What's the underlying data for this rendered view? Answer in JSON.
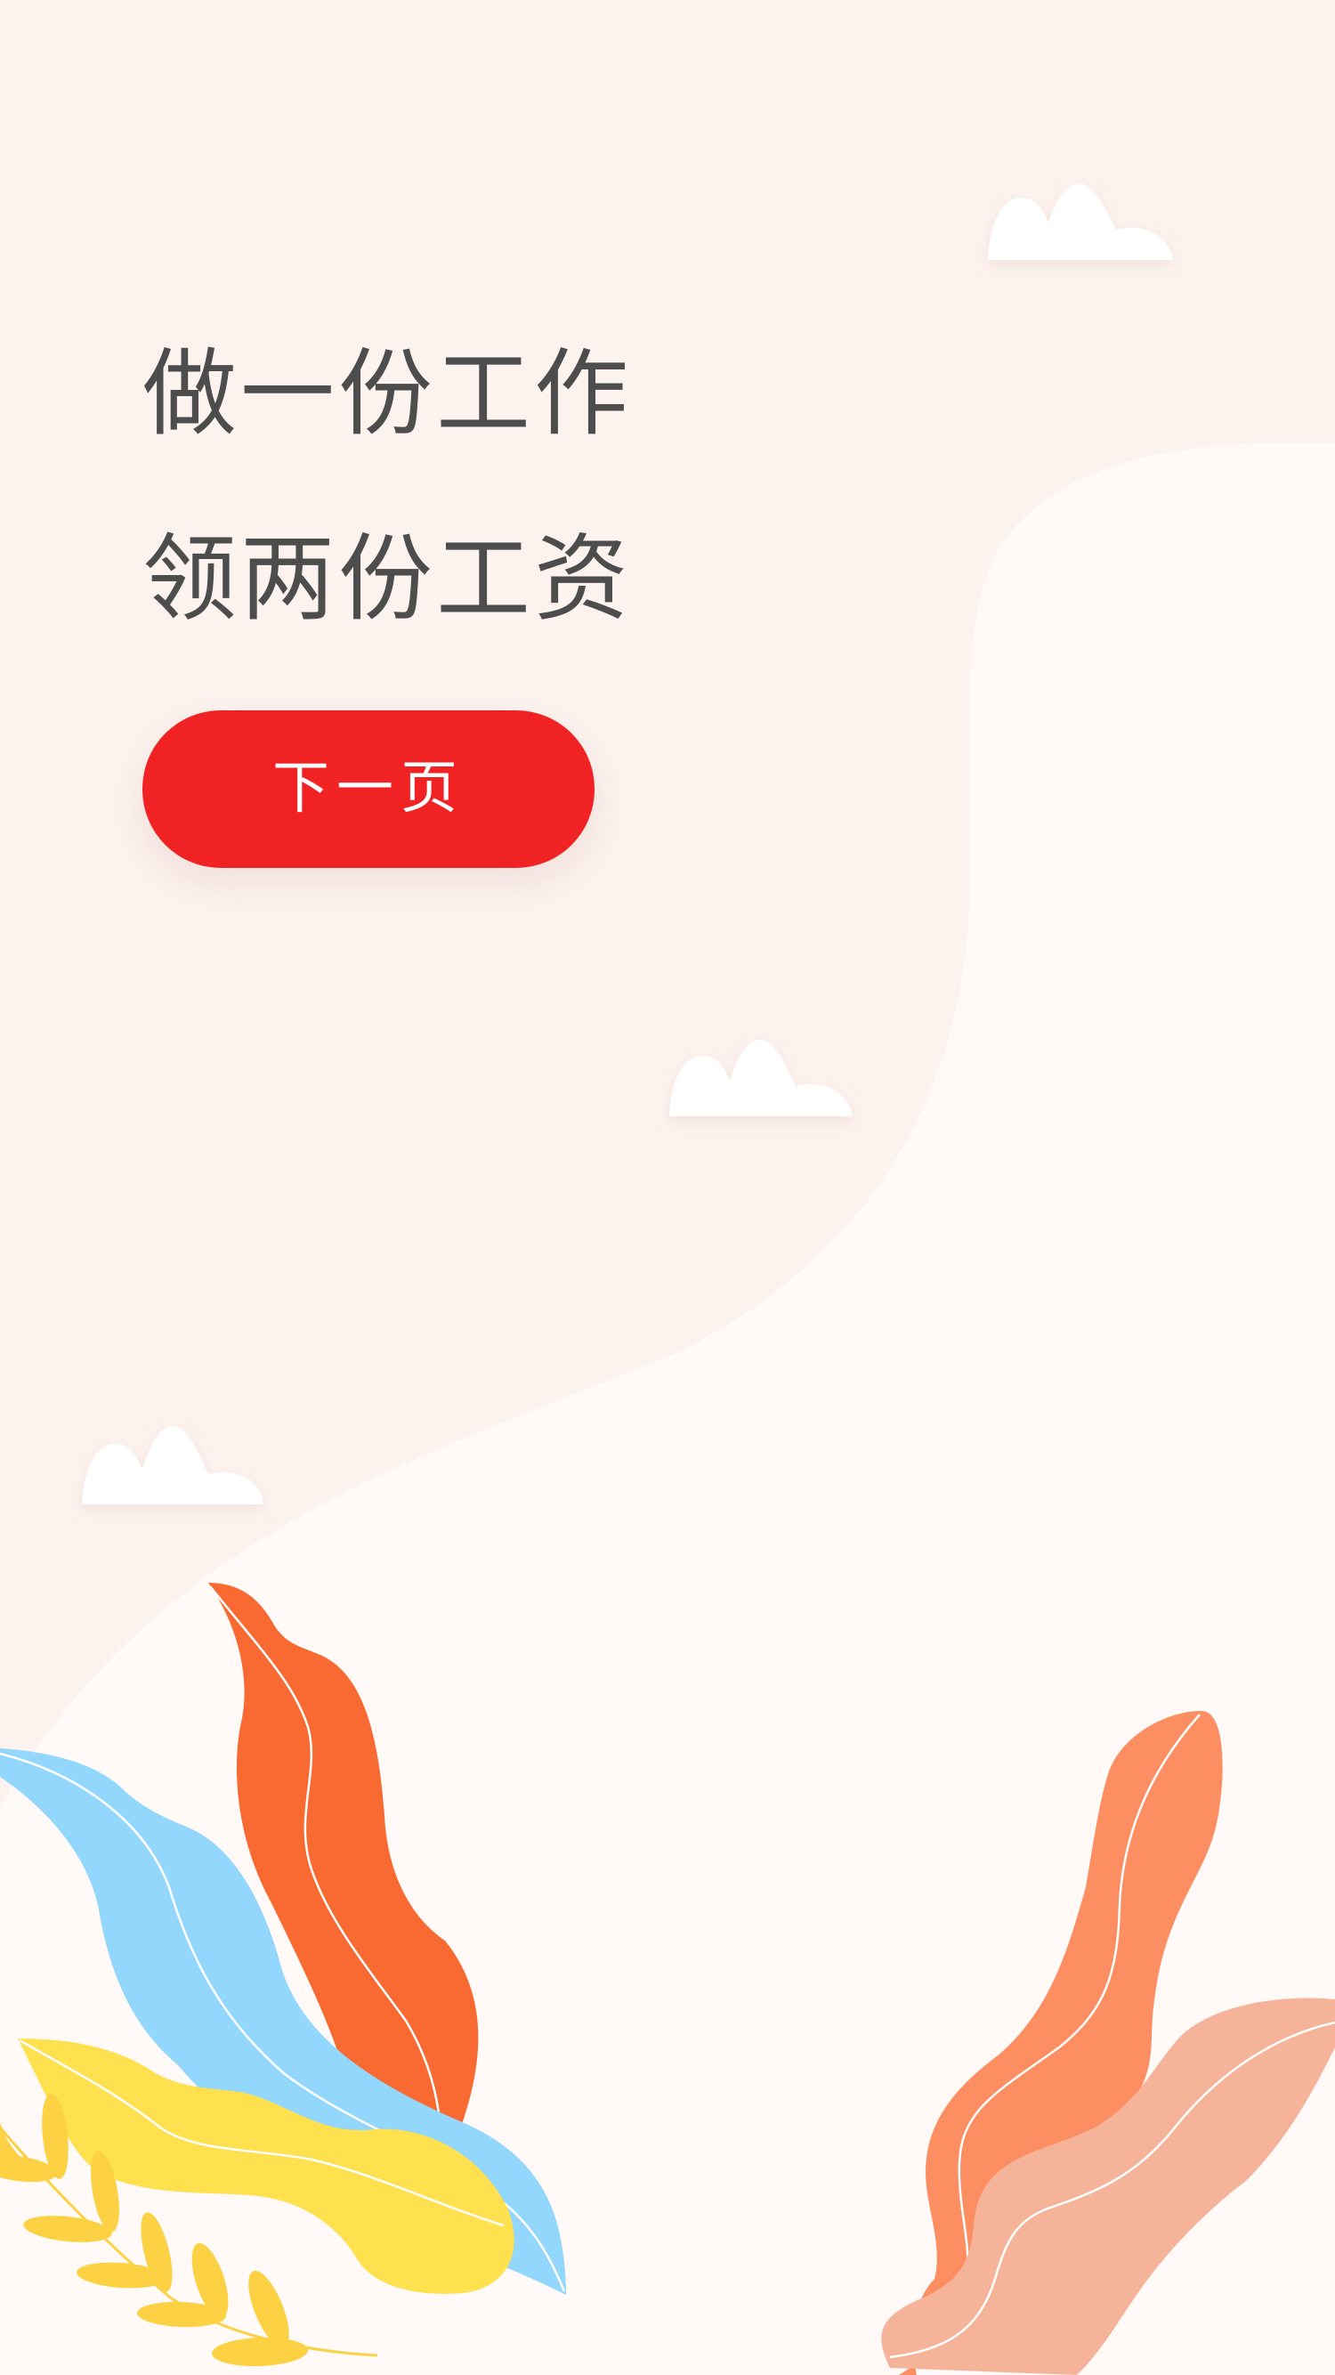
{
  "headline": {
    "line1": "做一份工作",
    "line2": "领两份工资"
  },
  "next_button": {
    "label": "下一页"
  },
  "colors": {
    "background": "#fffaf8",
    "background_band": "#fcf2ee",
    "headline_text": "#4d4d4d",
    "button_bg": "#f02223",
    "button_text": "#ffffff",
    "cloud": "#ffffff",
    "leaf_orange": "#f86a32",
    "leaf_blue": "#93d7fc",
    "leaf_yellow": "#ffe04e",
    "leaf_yellow_sprig": "#fcd244",
    "leaf_salmon": "#fc8e62",
    "leaf_peach": "#f5b49a"
  }
}
